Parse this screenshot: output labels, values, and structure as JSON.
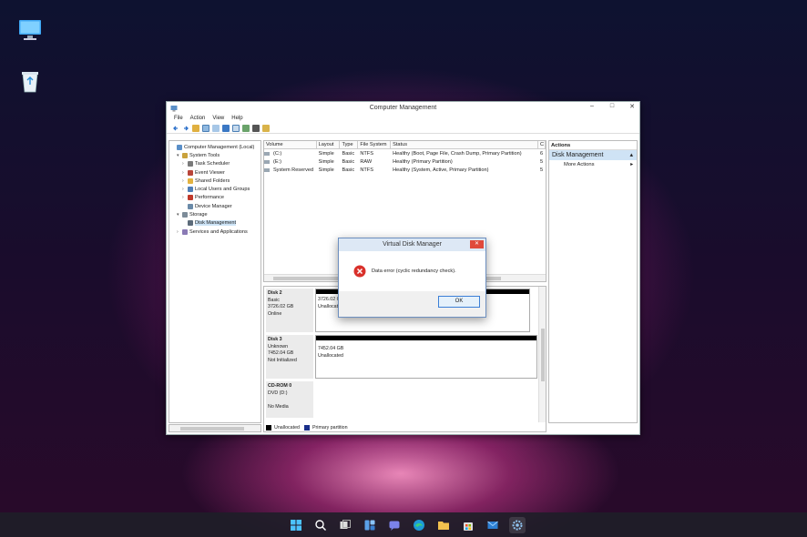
{
  "window": {
    "title": "Computer Management",
    "controls": [
      "–",
      "□",
      "✕"
    ]
  },
  "menu": [
    "File",
    "Action",
    "View",
    "Help"
  ],
  "tree": [
    {
      "label": "Computer Management (Local)",
      "indent": 0,
      "twisty": "",
      "icon": "computer-icon"
    },
    {
      "label": "System Tools",
      "indent": 1,
      "twisty": "▾",
      "icon": "tools-icon"
    },
    {
      "label": "Task Scheduler",
      "indent": 2,
      "twisty": "›",
      "icon": "clock-icon"
    },
    {
      "label": "Event Viewer",
      "indent": 2,
      "twisty": "›",
      "icon": "event-icon"
    },
    {
      "label": "Shared Folders",
      "indent": 2,
      "twisty": "›",
      "icon": "folder-icon"
    },
    {
      "label": "Local Users and Groups",
      "indent": 2,
      "twisty": "›",
      "icon": "users-icon"
    },
    {
      "label": "Performance",
      "indent": 2,
      "twisty": "›",
      "icon": "performance-icon"
    },
    {
      "label": "Device Manager",
      "indent": 2,
      "twisty": "",
      "icon": "device-icon"
    },
    {
      "label": "Storage",
      "indent": 1,
      "twisty": "▾",
      "icon": "storage-icon"
    },
    {
      "label": "Disk Management",
      "indent": 2,
      "twisty": "",
      "icon": "disk-icon",
      "selected": true
    },
    {
      "label": "Services and Applications",
      "indent": 1,
      "twisty": "›",
      "icon": "services-icon"
    }
  ],
  "volumes": {
    "headers": [
      "Volume",
      "Layout",
      "Type",
      "File System",
      "Status",
      "C"
    ],
    "rows": [
      [
        "(C:)",
        "Simple",
        "Basic",
        "NTFS",
        "Healthy (Boot, Page File, Crash Dump, Primary Partition)",
        "6"
      ],
      [
        "(E:)",
        "Simple",
        "Basic",
        "RAW",
        "Healthy (Primary Partition)",
        "5"
      ],
      [
        "System Reserved",
        "Simple",
        "Basic",
        "NTFS",
        "Healthy (System, Active, Primary Partition)",
        "5"
      ]
    ]
  },
  "disks": [
    {
      "name": "Disk 2",
      "type": "Basic",
      "size": "3726.02 GB",
      "status": "Online",
      "part_size": "3726.02 G",
      "part_label": "Unallocated"
    },
    {
      "name": "Disk 3",
      "type": "Unknown",
      "size": "7452.04 GB",
      "status": "Not Initialized",
      "part_size": "7452.04 GB",
      "part_label": "Unallocated"
    },
    {
      "name": "CD-ROM 0",
      "type": "DVD (D:)",
      "size": "",
      "status": "No Media",
      "part_size": "",
      "part_label": ""
    }
  ],
  "legend": {
    "unallocated": "Unallocated",
    "primary": "Primary partition"
  },
  "actions": {
    "header": "Actions",
    "selected": "Disk Management",
    "more": "More Actions"
  },
  "dialog": {
    "title": "Virtual Disk Manager",
    "message": "Data error (cyclic redundancy check).",
    "ok": "OK",
    "close": "✕"
  },
  "colors": {
    "selection": "#cde4f7",
    "error": "#d9302a",
    "primary_partition": "#1a2f8a"
  }
}
